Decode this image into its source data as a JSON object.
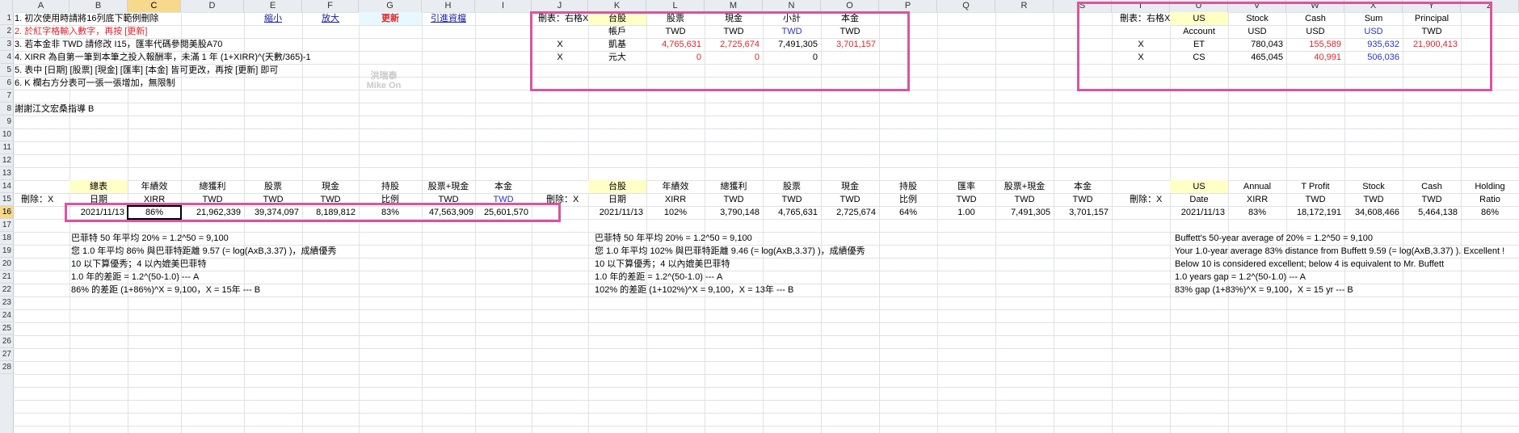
{
  "columns": [
    "A",
    "B",
    "C",
    "D",
    "E",
    "F",
    "G",
    "H",
    "I",
    "J",
    "K",
    "L",
    "M",
    "N",
    "O",
    "P",
    "Q",
    "R",
    "S",
    "T",
    "U",
    "V",
    "W",
    "X",
    "Y",
    "Z"
  ],
  "selected_column": "C",
  "rows": [
    "1",
    "2",
    "3",
    "4",
    "5",
    "6",
    "7",
    "8",
    "9",
    "10",
    "11",
    "12",
    "13",
    "14",
    "15",
    "16",
    "17",
    "18",
    "19",
    "20",
    "21",
    "22",
    "23",
    "24",
    "25",
    "26",
    "27",
    "28"
  ],
  "selected_row": "16",
  "instructions": {
    "line1": "1. 初次使用時請將16列底下範例刪除",
    "line2": "2. 於紅字格輸入數字，再按 [更新]",
    "line3": "3. 若本金非 TWD 請修改 I15，匯率代碼參閱美股A70",
    "line4": "4. XIRR 為自第一筆到本筆之投入報酬率，未滿 1 年 (1+XIRR)^(天數/365)-1",
    "line5": "5. 表中 [日期] [股票] [現金] [匯率] [本金] 皆可更改，再按 [更新] 即可",
    "line6": "6. K 欄右方分表可一張一張增加，無限制",
    "thanks": "謝謝江文宏桑指導 B"
  },
  "buttons": {
    "shrink": "縮小",
    "enlarge": "放大",
    "update": "更新",
    "guide": "引進資檔"
  },
  "watermark": {
    "line1": "洪瑞泰",
    "line2": "Mike On"
  },
  "tw_table": {
    "delete_label": "刪表：右格X",
    "headers": [
      "台股",
      "股票",
      "現金",
      "小計",
      "本金"
    ],
    "subheaders": [
      "帳戶",
      "TWD",
      "TWD",
      "TWD",
      "TWD"
    ],
    "rows": [
      {
        "x": "X",
        "account": "凱基",
        "stock": "4,765,631",
        "cash": "2,725,674",
        "subtotal": "7,491,305",
        "principal": "3,701,157"
      },
      {
        "x": "X",
        "account": "元大",
        "stock": "0",
        "cash": "0",
        "subtotal": "0",
        "principal": ""
      }
    ]
  },
  "us_table": {
    "delete_label": "刪表：右格X",
    "headers": [
      "US",
      "Stock",
      "Cash",
      "Sum",
      "Principal"
    ],
    "subheaders": [
      "Account",
      "USD",
      "USD",
      "USD",
      "TWD"
    ],
    "rows": [
      {
        "x": "X",
        "account": "ET",
        "stock": "780,043",
        "cash": "155,589",
        "sum": "935,632",
        "principal": "21,900,413"
      },
      {
        "x": "X",
        "account": "CS",
        "stock": "465,045",
        "cash": "40,991",
        "sum": "506,036",
        "principal": ""
      }
    ]
  },
  "summary_total": {
    "headers": [
      "總表",
      "年績效",
      "總獲利",
      "股票",
      "現金",
      "持股",
      "股票+現金",
      "本金"
    ],
    "subheaders": [
      "日期",
      "XIRR",
      "TWD",
      "TWD",
      "TWD",
      "比例",
      "TWD",
      "TWD"
    ],
    "delete_label": "刪除：X",
    "row": [
      "2021/11/13",
      "86%",
      "21,962,339",
      "39,374,097",
      "8,189,812",
      "83%",
      "47,563,909",
      "25,601,570"
    ]
  },
  "summary_tw": {
    "headers": [
      "台股",
      "年績效",
      "總獲利",
      "股票",
      "現金",
      "持股",
      "匯率",
      "股票+現金",
      "本金"
    ],
    "subheaders": [
      "日期",
      "XIRR",
      "TWD",
      "TWD",
      "TWD",
      "比例",
      "TWD",
      "TWD",
      "TWD"
    ],
    "delete_label": "刪除：X",
    "row": [
      "2021/11/13",
      "102%",
      "3,790,148",
      "4,765,631",
      "2,725,674",
      "64%",
      "1.00",
      "7,491,305",
      "3,701,157"
    ]
  },
  "summary_us": {
    "headers": [
      "US",
      "Annual",
      "T Profit",
      "Stock",
      "Cash",
      "Holding"
    ],
    "subheaders": [
      "Date",
      "XIRR",
      "TWD",
      "TWD",
      "TWD",
      "Ratio"
    ],
    "delete_label": "刪除：X",
    "row": [
      "2021/11/13",
      "83%",
      "18,172,191",
      "34,608,466",
      "5,464,138",
      "86%"
    ]
  },
  "notes_total": [
    "巴菲特 50 年平均 20% = 1.2^50 = 9,100",
    "您 1.0 年平均 86% 與巴菲特距離 9.57 (= log(AxB,3.37) )，成績優秀",
    "10 以下算優秀；4 以內媲美巴菲特",
    "1.0 年的差距 = 1.2^(50-1.0) --- A",
    "86% 的差距 (1+86%)^X = 9,100，X = 15年 --- B"
  ],
  "notes_tw": [
    "巴菲特 50 年平均 20% = 1.2^50 = 9,100",
    "您 1.0 年平均 102% 與巴菲特距離 9.46 (= log(AxB,3.37) )，成績優秀",
    "10 以下算優秀；4 以內媲美巴菲特",
    "1.0 年的差距 = 1.2^(50-1.0) --- A",
    "102% 的差距 (1+102%)^X = 9,100，X = 13年 --- B"
  ],
  "notes_us": [
    "Buffett's 50-year average of 20% = 1.2^50 = 9,100",
    "Your 1.0-year average 83% distance from Buffett 9.59 (= log(AxB,3.37) ). Excellent !",
    "Below 10 is considered excellent; below 4 is equivalent to Mr. Buffett",
    "1.0 years gap = 1.2^(50-1.0) --- A",
    "83% gap (1+83%)^X = 9,100，X = 15 yr --- B"
  ],
  "colors": {
    "pink_box": "#d9559f",
    "red_value": "#e0242b",
    "blue_value": "#2a33c8",
    "header_yellow": "#ffffc6"
  }
}
